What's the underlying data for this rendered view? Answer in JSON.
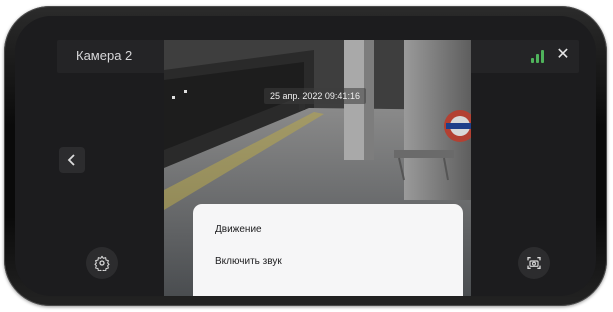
{
  "header": {
    "camera_name": "Камера 2"
  },
  "video": {
    "timestamp": "25 апр. 2022 09:41:16"
  },
  "menu": {
    "items": [
      {
        "label": "Движение"
      },
      {
        "label": "Включить звук"
      }
    ]
  },
  "icons": {
    "signal": "signal-strength-icon",
    "close": "close-icon",
    "back": "chevron-left-icon",
    "settings": "gear-icon",
    "snapshot": "camera-snapshot-icon"
  },
  "colors": {
    "signal": "#4fb35b",
    "sheet": "#f6f6f7",
    "screen": "#1c1c1e"
  },
  "signal_level": "3 of 3 bars"
}
